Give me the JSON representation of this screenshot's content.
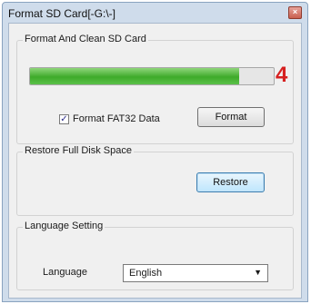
{
  "window": {
    "title": "Format SD Card[-G:\\-]",
    "close_glyph": "×"
  },
  "format_group": {
    "title": "Format And Clean SD Card",
    "progress_fraction": 0.86,
    "progress_number": "4",
    "checkbox_label": "Format FAT32 Data",
    "checkbox_checked": true,
    "format_button": "Format"
  },
  "restore_group": {
    "title": "Restore Full Disk Space",
    "restore_button": "Restore"
  },
  "language_group": {
    "title": "Language Setting",
    "language_label": "Language",
    "language_value": "English"
  },
  "icons": {
    "close": "close-icon",
    "checkmark": "checkmark-icon",
    "dropdown": "chevron-down-icon"
  },
  "colors": {
    "progress_fill": "#3eaa2a",
    "progress_number": "#d62020"
  }
}
